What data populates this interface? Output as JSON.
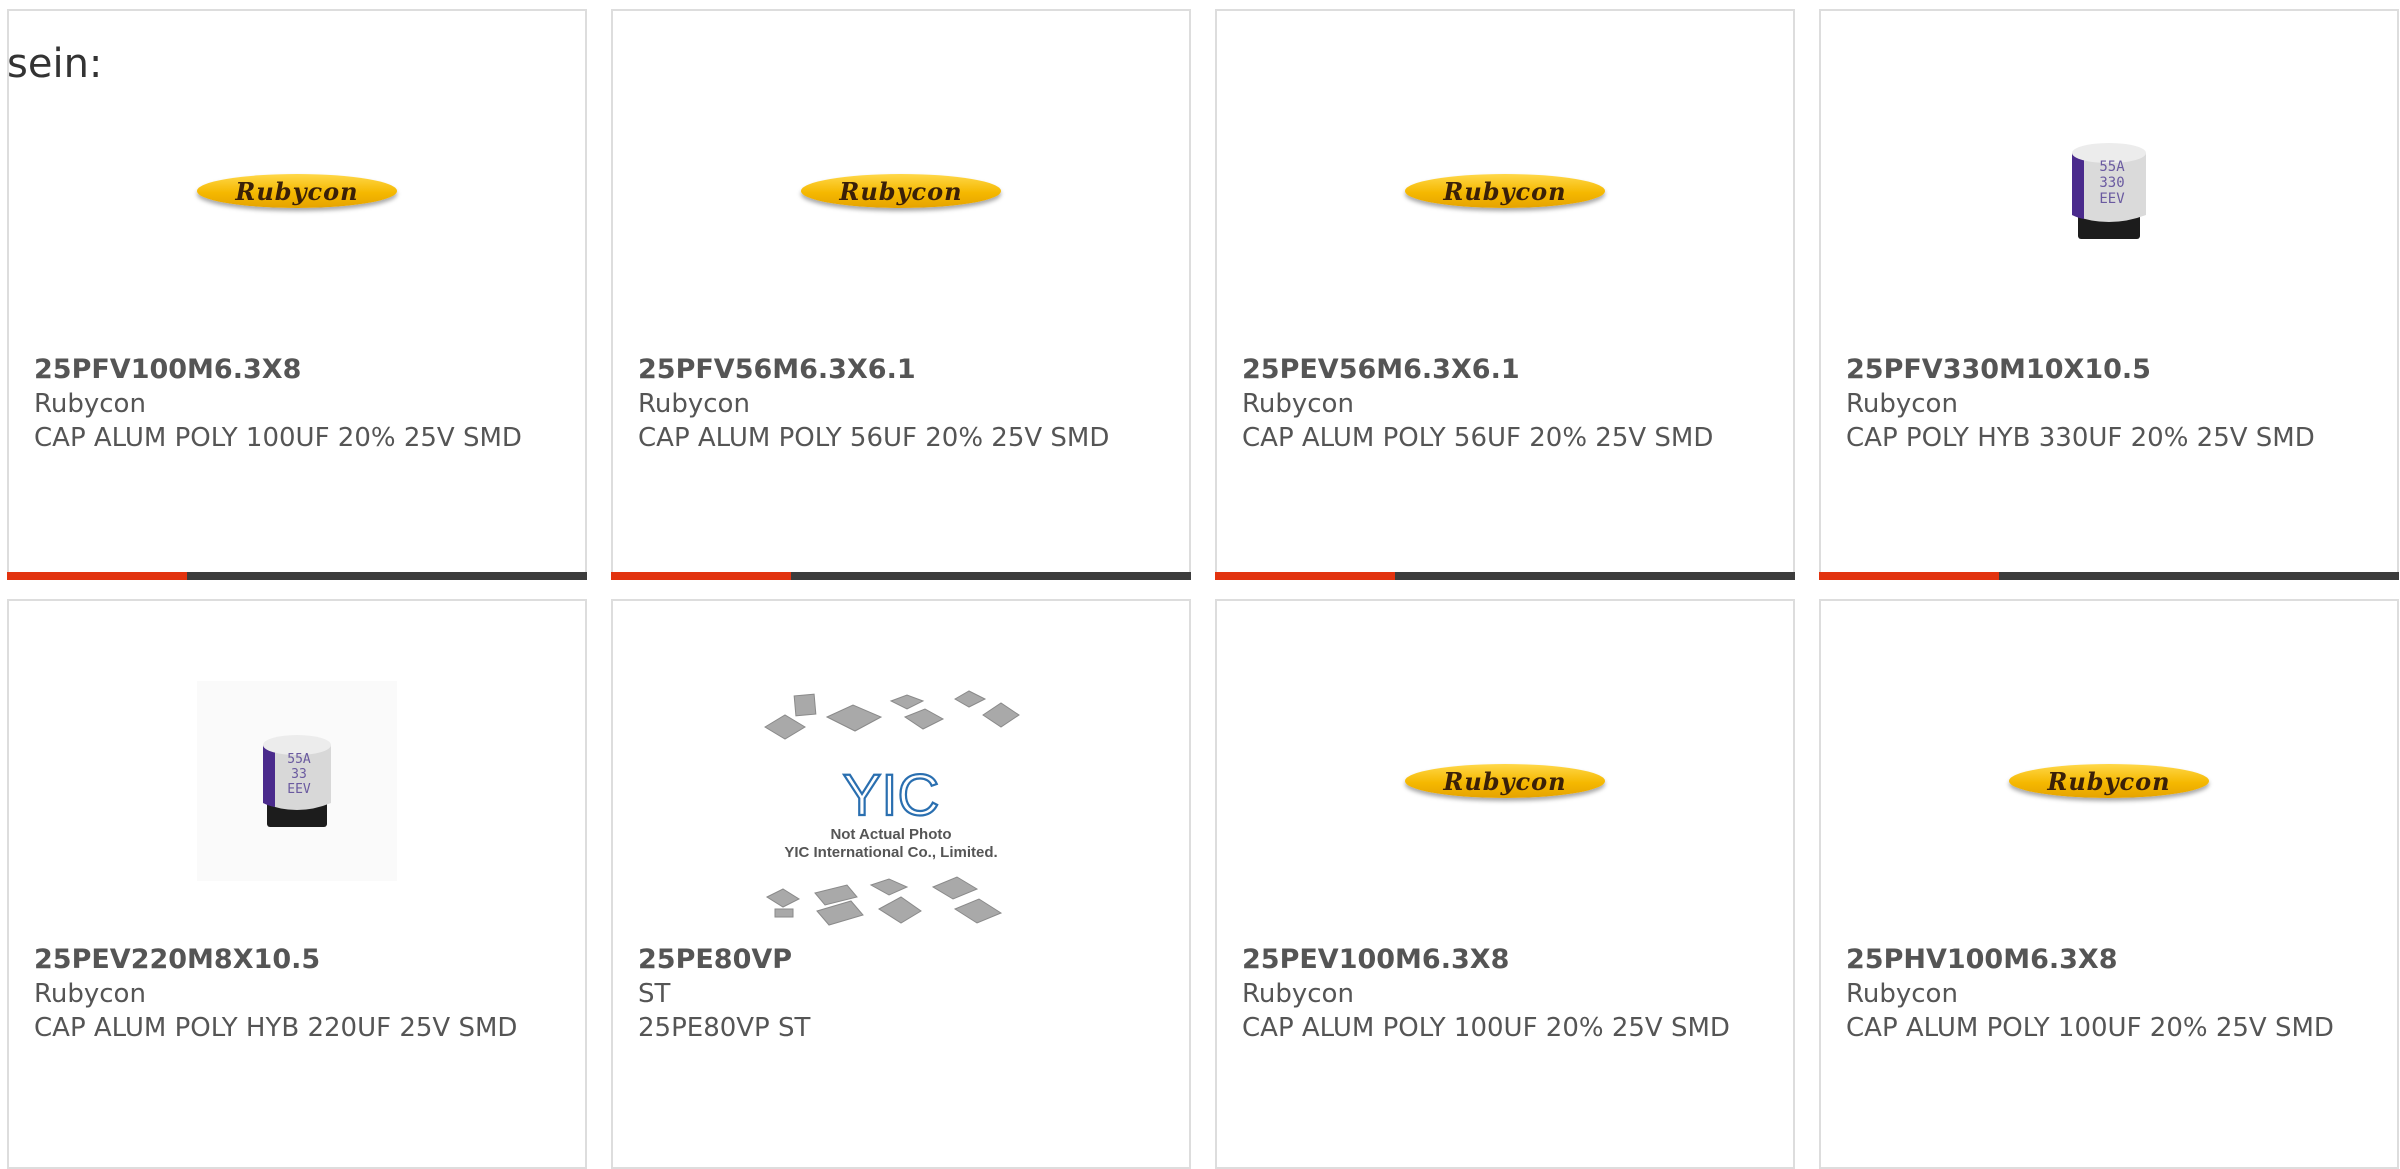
{
  "heading": "sein:",
  "products": [
    {
      "part_number": "25PFV100M6.3X8",
      "manufacturer": "Rubycon",
      "description": "CAP ALUM POLY 100UF 20% 25V SMD",
      "image": "rubycon-logo",
      "logo_text": "Rubycon",
      "bar_fill_fraction": 0.31
    },
    {
      "part_number": "25PFV56M6.3X6.1",
      "manufacturer": "Rubycon",
      "description": "CAP ALUM POLY 56UF 20% 25V SMD",
      "image": "rubycon-logo",
      "logo_text": "Rubycon",
      "bar_fill_fraction": 0.31
    },
    {
      "part_number": "25PEV56M6.3X6.1",
      "manufacturer": "Rubycon",
      "description": "CAP ALUM POLY 56UF 20% 25V SMD",
      "image": "rubycon-logo",
      "logo_text": "Rubycon",
      "bar_fill_fraction": 0.31
    },
    {
      "part_number": "25PFV330M10X10.5",
      "manufacturer": "Rubycon",
      "description": "CAP POLY HYB 330UF 20% 25V SMD",
      "image": "capacitor-photo",
      "cap_marking": [
        "55A",
        "330",
        "EEV"
      ],
      "bar_fill_fraction": 0.31
    },
    {
      "part_number": "25PEV220M8X10.5",
      "manufacturer": "Rubycon",
      "description": "CAP ALUM POLY HYB 220UF 25V SMD",
      "image": "capacitor-photo",
      "cap_marking": [
        "55A",
        "33",
        "EEV"
      ]
    },
    {
      "part_number": "25PE80VP",
      "manufacturer": "ST",
      "description": "25PE80VP ST",
      "image": "not-actual-photo",
      "placeholder_line1": "Not Actual Photo",
      "placeholder_line2": "YIC International Co., Limited.",
      "placeholder_logo": "YIC"
    },
    {
      "part_number": "25PEV100M6.3X8",
      "manufacturer": "Rubycon",
      "description": "CAP ALUM POLY 100UF 20% 25V SMD",
      "image": "rubycon-logo",
      "logo_text": "Rubycon"
    },
    {
      "part_number": "25PHV100M6.3X8",
      "manufacturer": "Rubycon",
      "description": "CAP ALUM POLY 100UF 20% 25V SMD",
      "image": "rubycon-logo",
      "logo_text": "Rubycon"
    }
  ],
  "colors": {
    "bar_accent": "#e2330f",
    "bar_track": "#3c3c3c",
    "card_border": "#dddddd",
    "text": "#555555"
  }
}
